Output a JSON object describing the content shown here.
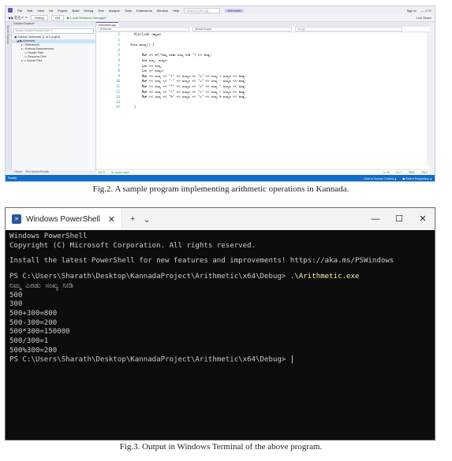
{
  "fig2": {
    "menu": [
      "File",
      "Edit",
      "View",
      "Git",
      "Project",
      "Build",
      "Debug",
      "Test",
      "Analyze",
      "Tools",
      "Extensions",
      "Window",
      "Help"
    ],
    "search_placeholder": "Search (Ctrl+Q)",
    "app_title": "Arithmetic",
    "sign_in": "Sign in",
    "live_share": "Live Share",
    "toolbar": {
      "config": "Debug",
      "platform": "x64",
      "run": "▶ Local Windows Debugger"
    },
    "solution_explorer": {
      "title": "Solution Explorer",
      "search_placeholder": "Search Solution Explorer (Ctrl+;)",
      "nodes": [
        "Solution 'Arithmetic' (1 of 1 project)",
        "Arithmetic",
        "References",
        "External Dependencies",
        "Header Files",
        "Resource Files",
        "Source Files"
      ]
    },
    "tab": "Arithmetic.cpp",
    "navbar": [
      "Arithmetic",
      "(Global Scope)",
      "ಮುಖ್ಯ()"
    ],
    "code_lines": [
      {
        "n": "1",
        "t": "    #include <ಕನ್ನಡ>"
      },
      {
        "n": "2",
        "t": ""
      },
      {
        "n": "3",
        "t": "  ⊟ಇಂಟ ಮುಖ್ಯ() {"
      },
      {
        "n": "4",
        "t": ""
      },
      {
        "n": "5",
        "t": "        ಔಟ್ << ಸ್(\"ನಿಮ್ಮ ಎರಡು ಸಂಖ್ಯ ನೀಡಿ \") << ಅಂತ್ಯ;"
      },
      {
        "n": "6",
        "t": "        ಅಂಕ ಸಂಖ್ಯ, ಸಂಖ್ಯ೨;"
      },
      {
        "n": "7",
        "t": "        ಓದು >> ಸಂಖ್ಯ;"
      },
      {
        "n": "8",
        "t": "        ಓದು >> ಸಂಖ್ಯ೨;"
      },
      {
        "n": "9",
        "t": "        ಔಟ್ << ಸಂಖ್ಯ << \"+\" << ಸಂಖ್ಯ೨ << \"=\" << ಸಂಖ್ಯ + ಸಂಖ್ಯ೨ << ಅಂತ್ಯ;"
      },
      {
        "n": "10",
        "t": "        ಔಟ್ << ಸಂಖ್ಯ << \"-\" << ಸಂಖ್ಯ೨ << \"=\" << ಸಂಖ್ಯ - ಸಂಖ್ಯ೨ << ಅಂತ್ಯ;"
      },
      {
        "n": "11",
        "t": "        ಔಟ್ << ಸಂಖ್ಯ << \"*\" << ಸಂಖ್ಯ೨ << \"=\" << ಸಂಖ್ಯ * ಸಂಖ್ಯ೨ << ಅಂತ್ಯ;"
      },
      {
        "n": "12",
        "t": "        ಔಟ್ << ಸಂಖ್ಯ << \"/\" << ಸಂಖ್ಯ೨ << \"=\" << ಸಂಖ್ಯ / ಸಂಖ್ಯ೨ << ಅಂತ್ಯ;"
      },
      {
        "n": "13",
        "t": "        ಔಟ್ << ಸಂಖ್ಯ << \"%\" << ಸಂಖ್ಯ೨ << \"=\" << ಸಂಖ್ಯ % ಸಂಖ್ಯ೨ << ಅಂತ್ಯ;"
      },
      {
        "n": "14",
        "t": ""
      },
      {
        "n": "15",
        "t": "    }"
      }
    ],
    "editor_status": {
      "zoom": "142 %",
      "issues": "No issues found",
      "ln": "Ln: 15",
      "ch": "Ch: 2",
      "ws": "TABS",
      "eol": "CRLF"
    },
    "bottom_tabs": [
      "Output",
      "Find Symbol Results"
    ],
    "status": {
      "ready": "Ready",
      "source_control": "↑ Add to Source Control ▴",
      "repo": "◆ Select Repository ▴"
    },
    "caption": "Fig.2. A sample program implementing arithmetic operations in Kannada."
  },
  "fig3": {
    "tab_title": "Windows PowerShell",
    "tab_close": "✕",
    "new_tab": "+",
    "dropdown": "⌄",
    "controls": {
      "minimize": "—",
      "maximize": "☐",
      "close": "✕"
    },
    "lines": [
      "Windows PowerShell",
      "Copyright (C) Microsoft Corporation. All rights reserved.",
      "",
      "Install the latest PowerShell for new features and improvements! https://aka.ms/PSWindows",
      ""
    ],
    "prompt": "PS C:\\Users\\Sharath\\Desktop\\KannadaProject\\Arithmetic\\x64\\Debug> ",
    "command": ".\\Arithmetic.exe",
    "output": [
      "ನಿಮ್ಮ ಎರಡು ಸಂಖ್ಯ ನೀಡಿ",
      "500",
      "300",
      "500+300=800",
      "500-300=200",
      "500*300=150000",
      "500/300=1",
      "500%300=200"
    ],
    "final_prompt": "PS C:\\Users\\Sharath\\Desktop\\KannadaProject\\Arithmetic\\x64\\Debug> ",
    "caption": "Fig.3. Output in Windows Terminal of the above program."
  }
}
